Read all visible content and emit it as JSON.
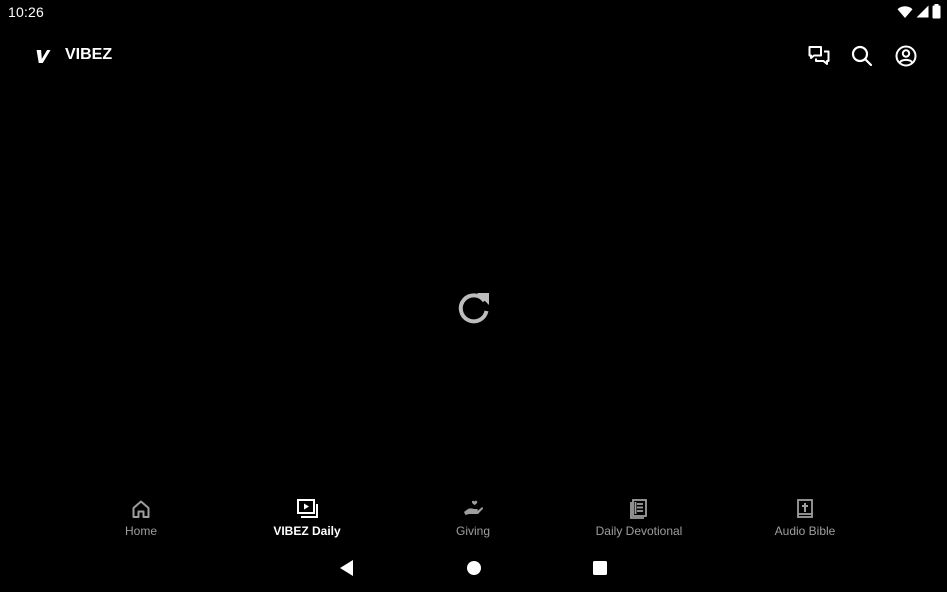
{
  "status_bar": {
    "time": "10:26",
    "icons": [
      "wifi-icon",
      "cellular-signal-icon",
      "battery-icon"
    ]
  },
  "app_bar": {
    "title": "VIBEZ",
    "logo_icon": "vibez-logo-icon",
    "actions": [
      "chat-icon",
      "search-icon",
      "account-icon"
    ]
  },
  "main": {
    "icon": "refresh-icon"
  },
  "bottom_nav": {
    "items": [
      {
        "label": "Home",
        "icon": "home-icon",
        "active": false
      },
      {
        "label": "VIBEZ Daily",
        "icon": "video-library-icon",
        "active": true
      },
      {
        "label": "Giving",
        "icon": "giving-hand-icon",
        "active": false
      },
      {
        "label": "Daily Devotional",
        "icon": "book-icon",
        "active": false
      },
      {
        "label": "Audio Bible",
        "icon": "bible-icon",
        "active": false
      }
    ]
  },
  "system_nav": {
    "buttons": [
      "back-icon",
      "home-circle-icon",
      "recents-icon"
    ]
  },
  "colors": {
    "background": "#000000",
    "text_primary": "#ffffff",
    "text_inactive": "#9e9e9e",
    "refresh_icon": "#bdbdbd"
  }
}
